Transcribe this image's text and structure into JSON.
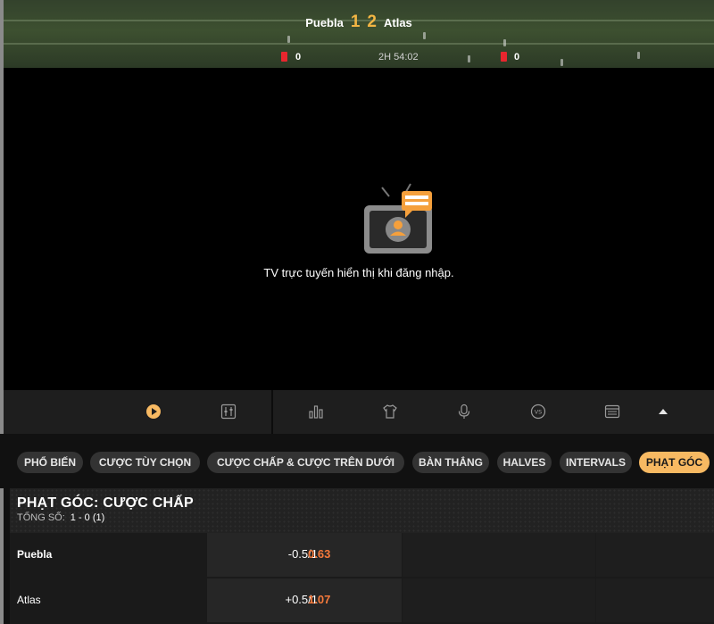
{
  "scoreboard": {
    "home_team": "Puebla",
    "away_team": "Atlas",
    "home_score": "1",
    "away_score": "2",
    "home_red_cards": "0",
    "away_red_cards": "0",
    "match_time": "2H 54:02"
  },
  "video": {
    "message": "TV trực tuyến hiển thị khi đăng nhập."
  },
  "toolbar": {
    "icons": [
      "play-icon",
      "stats-panel-icon",
      "bar-chart-icon",
      "jersey-icon",
      "microphone-icon",
      "versus-icon",
      "schedule-icon",
      "collapse-up-icon"
    ]
  },
  "tabs": [
    {
      "label": "PHỔ BIẾN",
      "active": false
    },
    {
      "label": "CƯỢC TÙY CHỌN",
      "active": false
    },
    {
      "label": "CƯỢC CHẤP & CƯỢC TRÊN DƯỚI",
      "active": false
    },
    {
      "label": "BÀN THẮNG",
      "active": false
    },
    {
      "label": "HALVES",
      "active": false
    },
    {
      "label": "INTERVALS",
      "active": false
    },
    {
      "label": "PHẠT GÓC",
      "active": true
    }
  ],
  "market": {
    "title": "PHẠT GÓC: CƯỢC CHẤP",
    "total_label": "TỔNG SỐ:",
    "total_value": "1 - 0 (1)",
    "rows": [
      {
        "team": "Puebla",
        "handicap": "-0.5/1",
        "odds": "0.63"
      },
      {
        "team": "Atlas",
        "handicap": "+0.5/1",
        "odds": "1.07"
      }
    ]
  },
  "colors": {
    "accent": "#f7b962",
    "score": "#f2b544",
    "odds": "#f5793b",
    "red_card": "#e8262e"
  }
}
